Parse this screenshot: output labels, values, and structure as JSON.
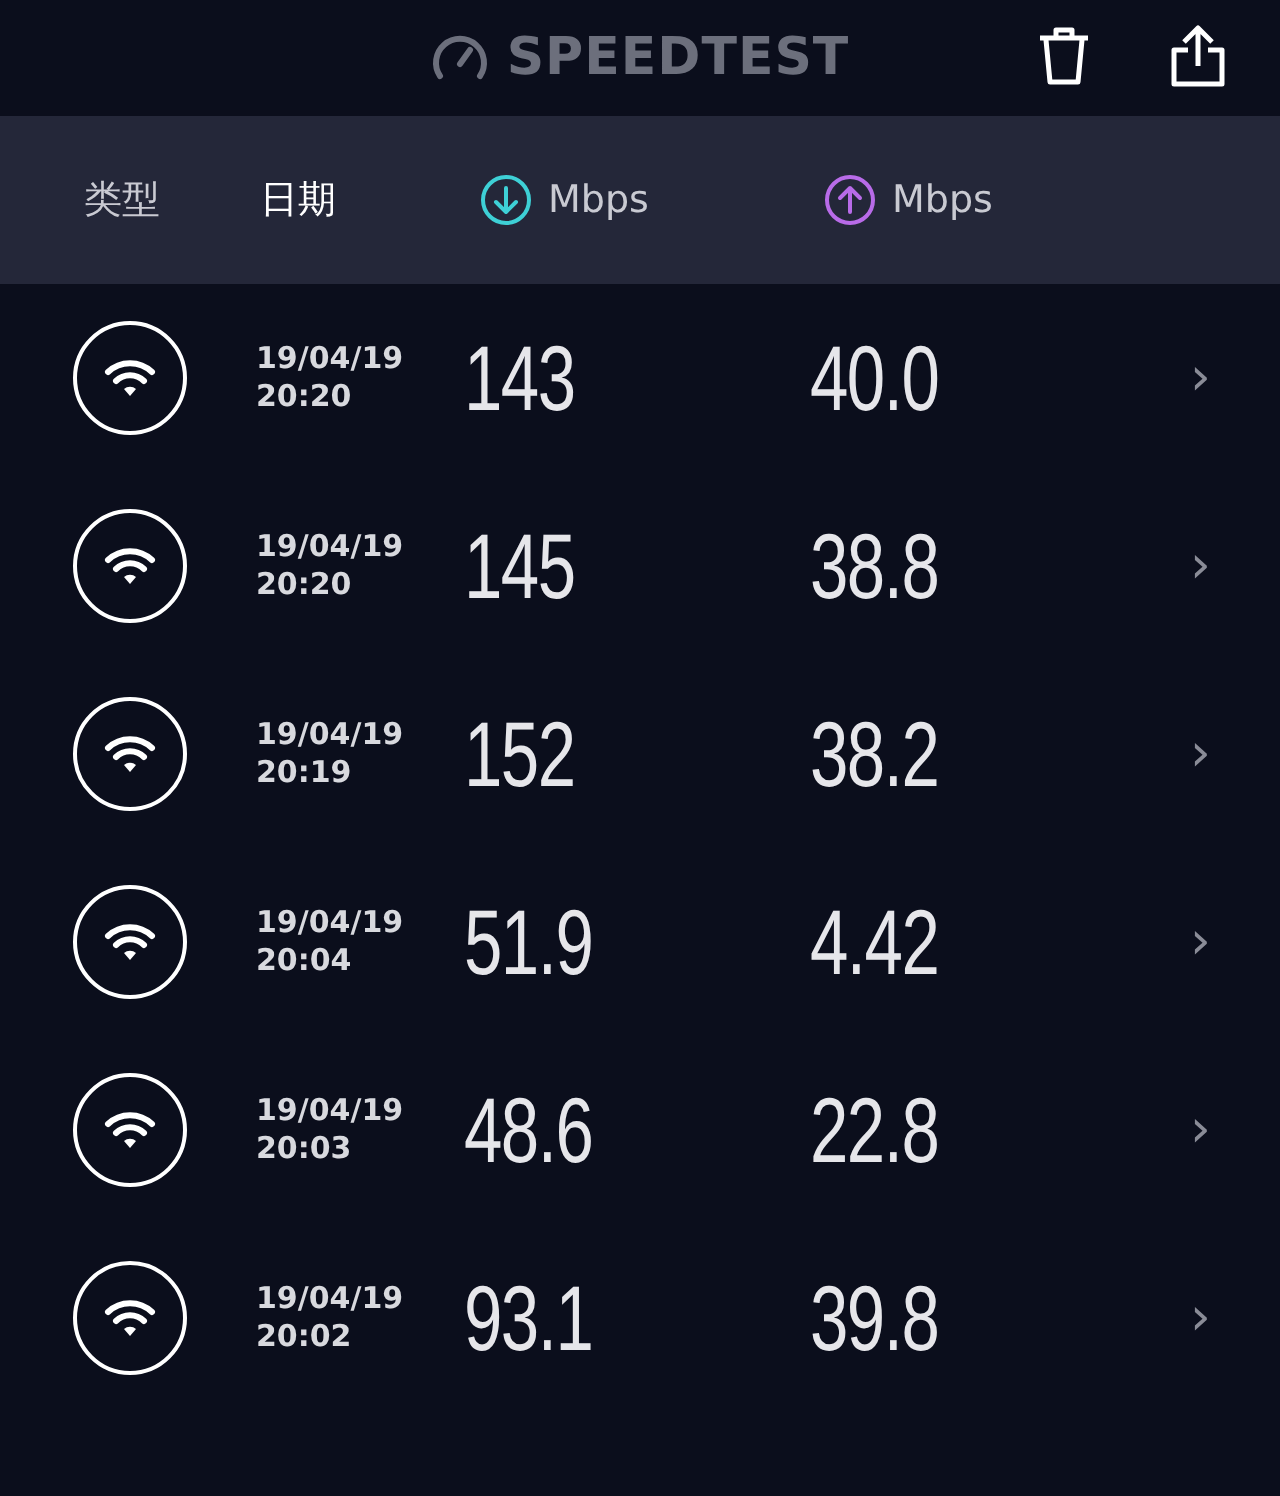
{
  "header": {
    "title": "SPEEDTEST"
  },
  "columns": [
    {
      "kind": "text",
      "label": "类型",
      "selected": false
    },
    {
      "kind": "text",
      "label": "日期",
      "selected": true
    },
    {
      "kind": "download",
      "label": "Mbps",
      "selected": false
    },
    {
      "kind": "upload",
      "label": "Mbps",
      "selected": false
    }
  ],
  "rows": [
    {
      "date": "19/04/19",
      "time": "20:20",
      "download": "143",
      "upload": "40.0",
      "chevron": "›"
    },
    {
      "date": "19/04/19",
      "time": "20:20",
      "download": "145",
      "upload": "38.8",
      "chevron": "›"
    },
    {
      "date": "19/04/19",
      "time": "20:19",
      "download": "152",
      "upload": "38.2",
      "chevron": "›"
    },
    {
      "date": "19/04/19",
      "time": "20:04",
      "download": "51.9",
      "upload": "4.42",
      "chevron": "›"
    },
    {
      "date": "19/04/19",
      "time": "20:03",
      "download": "48.6",
      "upload": "22.8",
      "chevron": "›"
    },
    {
      "date": "19/04/19",
      "time": "20:02",
      "download": "93.1",
      "upload": "39.8",
      "chevron": "›"
    }
  ]
}
